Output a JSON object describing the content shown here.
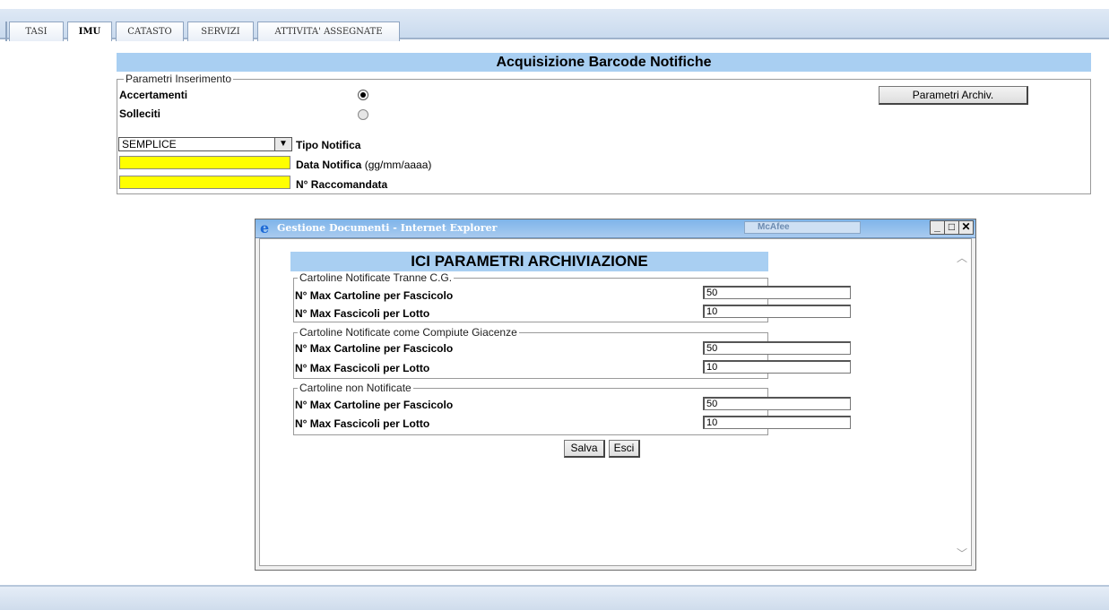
{
  "tabs": [
    {
      "label": "TASI"
    },
    {
      "label": "IMU"
    },
    {
      "label": "CATASTO"
    },
    {
      "label": "SERVIZI"
    },
    {
      "label": "ATTIVITA' ASSEGNATE"
    }
  ],
  "active_tab": "IMU",
  "main": {
    "title": "Acquisizione Barcode Notifiche",
    "legend": "Parametri Inserimento",
    "accertamenti_label": "Accertamenti",
    "solleciti_label": "Solleciti",
    "selected_option": "Accertamenti",
    "parametri_button": "Parametri Archiv.",
    "tipo_notifica_value": "SEMPLICE",
    "tipo_notifica_label": "Tipo Notifica",
    "data_notifica_label": "Data Notifica",
    "data_notifica_hint": "(gg/mm/aaaa)",
    "data_notifica_value": "",
    "raccomandata_label": "N° Raccomandata",
    "raccomandata_value": ""
  },
  "popup": {
    "window_title": "Gestione Documenti - Internet Explorer",
    "mcafee_label": "McAfee",
    "title": "ICI PARAMETRI ARCHIVIAZIONE",
    "groups": [
      {
        "legend": "Cartoline Notificate Tranne C.G.",
        "max_cartoline_label": "N° Max Cartoline per Fascicolo",
        "max_cartoline_value": "50",
        "max_fascicoli_label": "N° Max Fascicoli per Lotto",
        "max_fascicoli_value": "10"
      },
      {
        "legend": "Cartoline Notificate come Compiute Giacenze",
        "max_cartoline_label": "N° Max Cartoline per Fascicolo",
        "max_cartoline_value": "50",
        "max_fascicoli_label": "N° Max Fascicoli per Lotto",
        "max_fascicoli_value": "10"
      },
      {
        "legend": "Cartoline non Notificate",
        "max_cartoline_label": "N° Max Cartoline per Fascicolo",
        "max_cartoline_value": "50",
        "max_fascicoli_label": "N° Max Fascicoli per Lotto",
        "max_fascicoli_value": "10"
      }
    ],
    "salva_label": "Salva",
    "esci_label": "Esci"
  }
}
